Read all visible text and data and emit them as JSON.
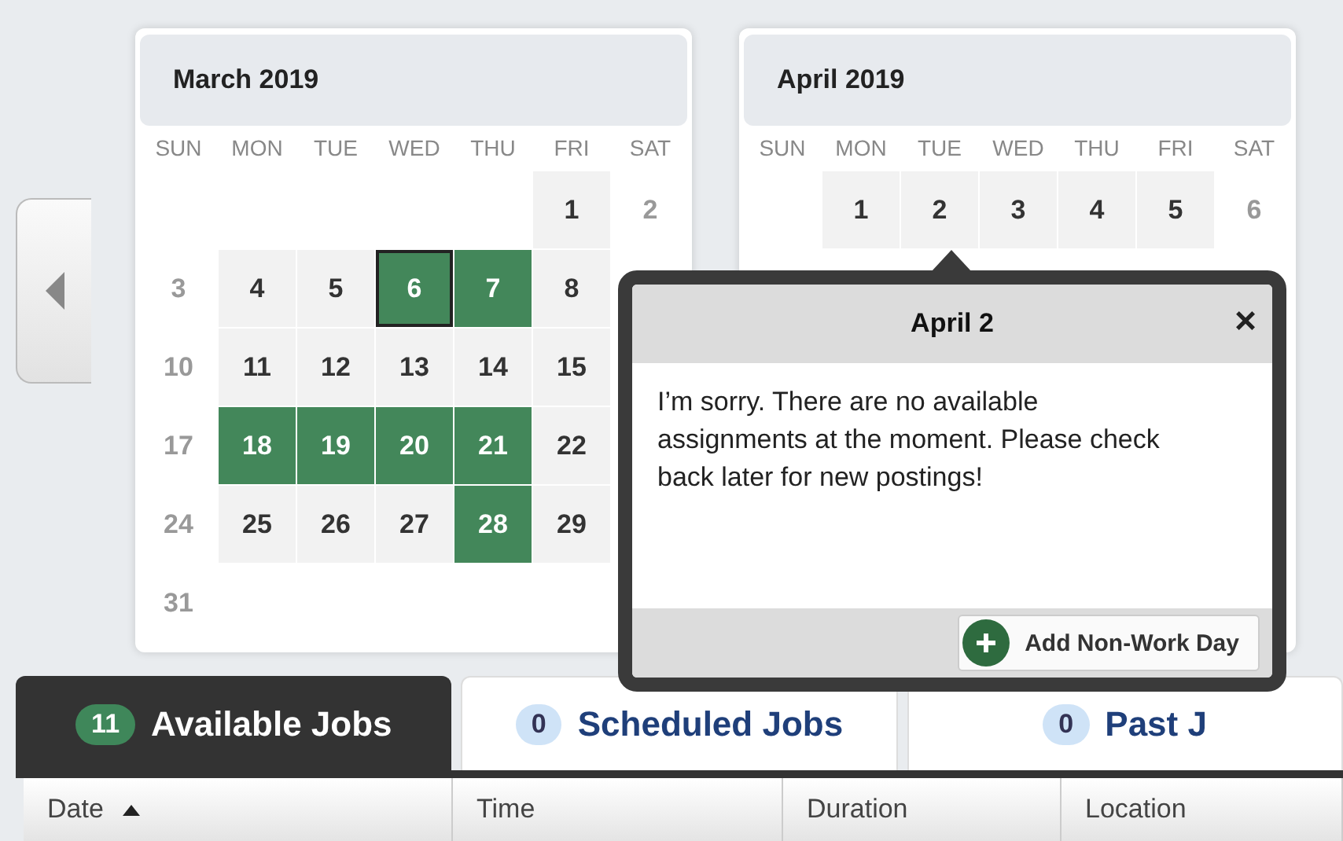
{
  "calendars": [
    {
      "title": "March 2019",
      "weekdays": [
        "SUN",
        "MON",
        "TUE",
        "WED",
        "THU",
        "FRI",
        "SAT"
      ],
      "days": [
        {
          "day": "1",
          "kind": "workday",
          "selected": false
        },
        {
          "day": "2",
          "kind": "weekend",
          "selected": false
        },
        {
          "day": "3",
          "kind": "weekend",
          "selected": false
        },
        {
          "day": "4",
          "kind": "workday",
          "selected": false
        },
        {
          "day": "5",
          "kind": "workday",
          "selected": false
        },
        {
          "day": "6",
          "kind": "available",
          "selected": true
        },
        {
          "day": "7",
          "kind": "available",
          "selected": false
        },
        {
          "day": "8",
          "kind": "workday",
          "selected": false
        },
        {
          "day": "10",
          "kind": "weekend",
          "selected": false
        },
        {
          "day": "11",
          "kind": "workday",
          "selected": false
        },
        {
          "day": "12",
          "kind": "workday",
          "selected": false
        },
        {
          "day": "13",
          "kind": "workday",
          "selected": false
        },
        {
          "day": "14",
          "kind": "workday",
          "selected": false
        },
        {
          "day": "15",
          "kind": "workday",
          "selected": false
        },
        {
          "day": "17",
          "kind": "weekend",
          "selected": false
        },
        {
          "day": "18",
          "kind": "available",
          "selected": false
        },
        {
          "day": "19",
          "kind": "available",
          "selected": false
        },
        {
          "day": "20",
          "kind": "available",
          "selected": false
        },
        {
          "day": "21",
          "kind": "available",
          "selected": false
        },
        {
          "day": "22",
          "kind": "workday",
          "selected": false
        },
        {
          "day": "24",
          "kind": "weekend",
          "selected": false
        },
        {
          "day": "25",
          "kind": "workday",
          "selected": false
        },
        {
          "day": "26",
          "kind": "workday",
          "selected": false
        },
        {
          "day": "27",
          "kind": "workday",
          "selected": false
        },
        {
          "day": "28",
          "kind": "available",
          "selected": false
        },
        {
          "day": "29",
          "kind": "workday",
          "selected": false
        },
        {
          "day": "31",
          "kind": "weekend",
          "selected": false
        }
      ]
    },
    {
      "title": "April 2019",
      "weekdays": [
        "SUN",
        "MON",
        "TUE",
        "WED",
        "THU",
        "FRI",
        "SAT"
      ],
      "days": [
        {
          "day": "1",
          "kind": "workday",
          "selected": false
        },
        {
          "day": "2",
          "kind": "workday",
          "selected": false
        },
        {
          "day": "3",
          "kind": "workday",
          "selected": false
        },
        {
          "day": "4",
          "kind": "workday",
          "selected": false
        },
        {
          "day": "5",
          "kind": "workday",
          "selected": false
        },
        {
          "day": "6",
          "kind": "weekend",
          "selected": false
        }
      ]
    }
  ],
  "popup": {
    "title": "April 2",
    "close": "×",
    "message": "I’m sorry. There are no available assignments at the moment. Please check back later for new postings!",
    "button": "Add Non-Work Day"
  },
  "tabs": [
    {
      "count": "11",
      "label": "Available Jobs",
      "selected": true
    },
    {
      "count": "0",
      "label": "Scheduled Jobs",
      "selected": false
    },
    {
      "count": "0",
      "label": "Past J",
      "selected": false
    }
  ],
  "table": {
    "columns": [
      {
        "label": "Date",
        "sorted": true
      },
      {
        "label": "Time",
        "sorted": false
      },
      {
        "label": "Duration",
        "sorted": false
      },
      {
        "label": "Location",
        "sorted": false
      }
    ]
  }
}
